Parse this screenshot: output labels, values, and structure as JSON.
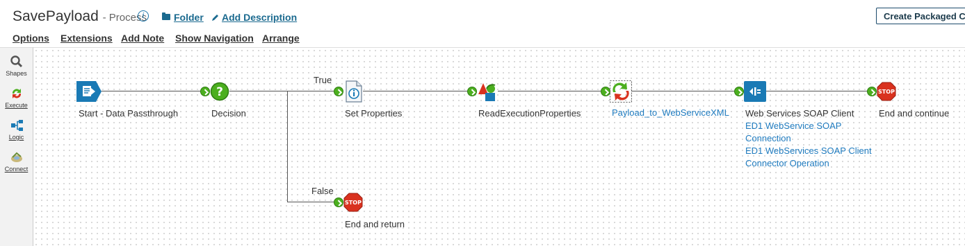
{
  "header": {
    "title": "SavePayload",
    "subtitle": "- Process",
    "folder_link": "Folder",
    "add_description_link": "Add Description",
    "create_packaged_button": "Create Packaged C"
  },
  "menu": {
    "options": "Options",
    "extensions": "Extensions",
    "add_note": "Add Note",
    "show_navigation": "Show Navigation",
    "arrange": "Arrange"
  },
  "sidebar": {
    "items": [
      {
        "label": "Shapes",
        "icon": "search-icon"
      },
      {
        "label": "Execute",
        "icon": "execute-icon"
      },
      {
        "label": "Logic",
        "icon": "logic-icon"
      },
      {
        "label": "Connect",
        "icon": "connect-icon"
      }
    ]
  },
  "process": {
    "shapes": [
      {
        "label": "Start - Data Passthrough",
        "icon": "start-icon"
      },
      {
        "label": "Decision",
        "icon": "decision-icon"
      },
      {
        "label": "Set Properties",
        "icon": "set-properties-icon"
      },
      {
        "label": "ReadExecutionProperties",
        "icon": "map-icon"
      },
      {
        "label": "Payload_to_WebServiceXML",
        "icon": "transform-icon"
      },
      {
        "label": "Web Services SOAP Client",
        "icon": "connector-icon",
        "connection_line1": "ED1 WebService SOAP",
        "connection_line2": "Connection",
        "operation_line1": "ED1 WebServices SOAP Client",
        "operation_line2": "Connector Operation"
      },
      {
        "label": "End and continue",
        "icon": "stop-icon"
      },
      {
        "label": "End and return",
        "icon": "stop-icon"
      }
    ],
    "branches": {
      "true_label": "True",
      "false_label": "False"
    }
  },
  "colors": {
    "link": "#1b6a8f",
    "shape_blue": "#1a7ab5",
    "stop_red": "#d9321f",
    "connector_green": "#4caf1f"
  }
}
